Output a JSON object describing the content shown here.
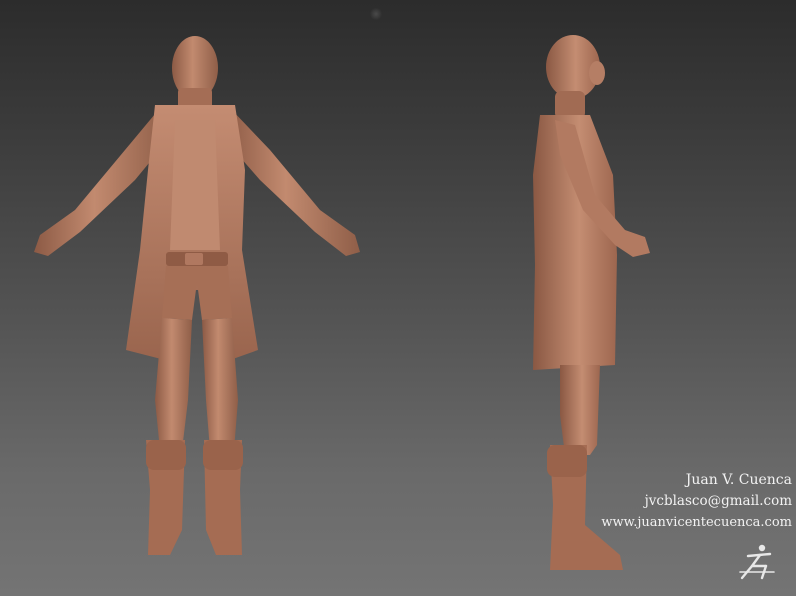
{
  "scene": {
    "background_top": "#2c2c2c",
    "background_bottom": "#747474",
    "clay_color": "#b77c63",
    "clay_shadow": "#8c5a45",
    "clay_highlight": "#d49a80"
  },
  "credits": {
    "name": "Juan V. Cuenca",
    "email": "jvcblasco@gmail.com",
    "website": "www.juanvicentecuenca.com"
  },
  "logo": {
    "icon": "zbrush-logo-icon"
  }
}
